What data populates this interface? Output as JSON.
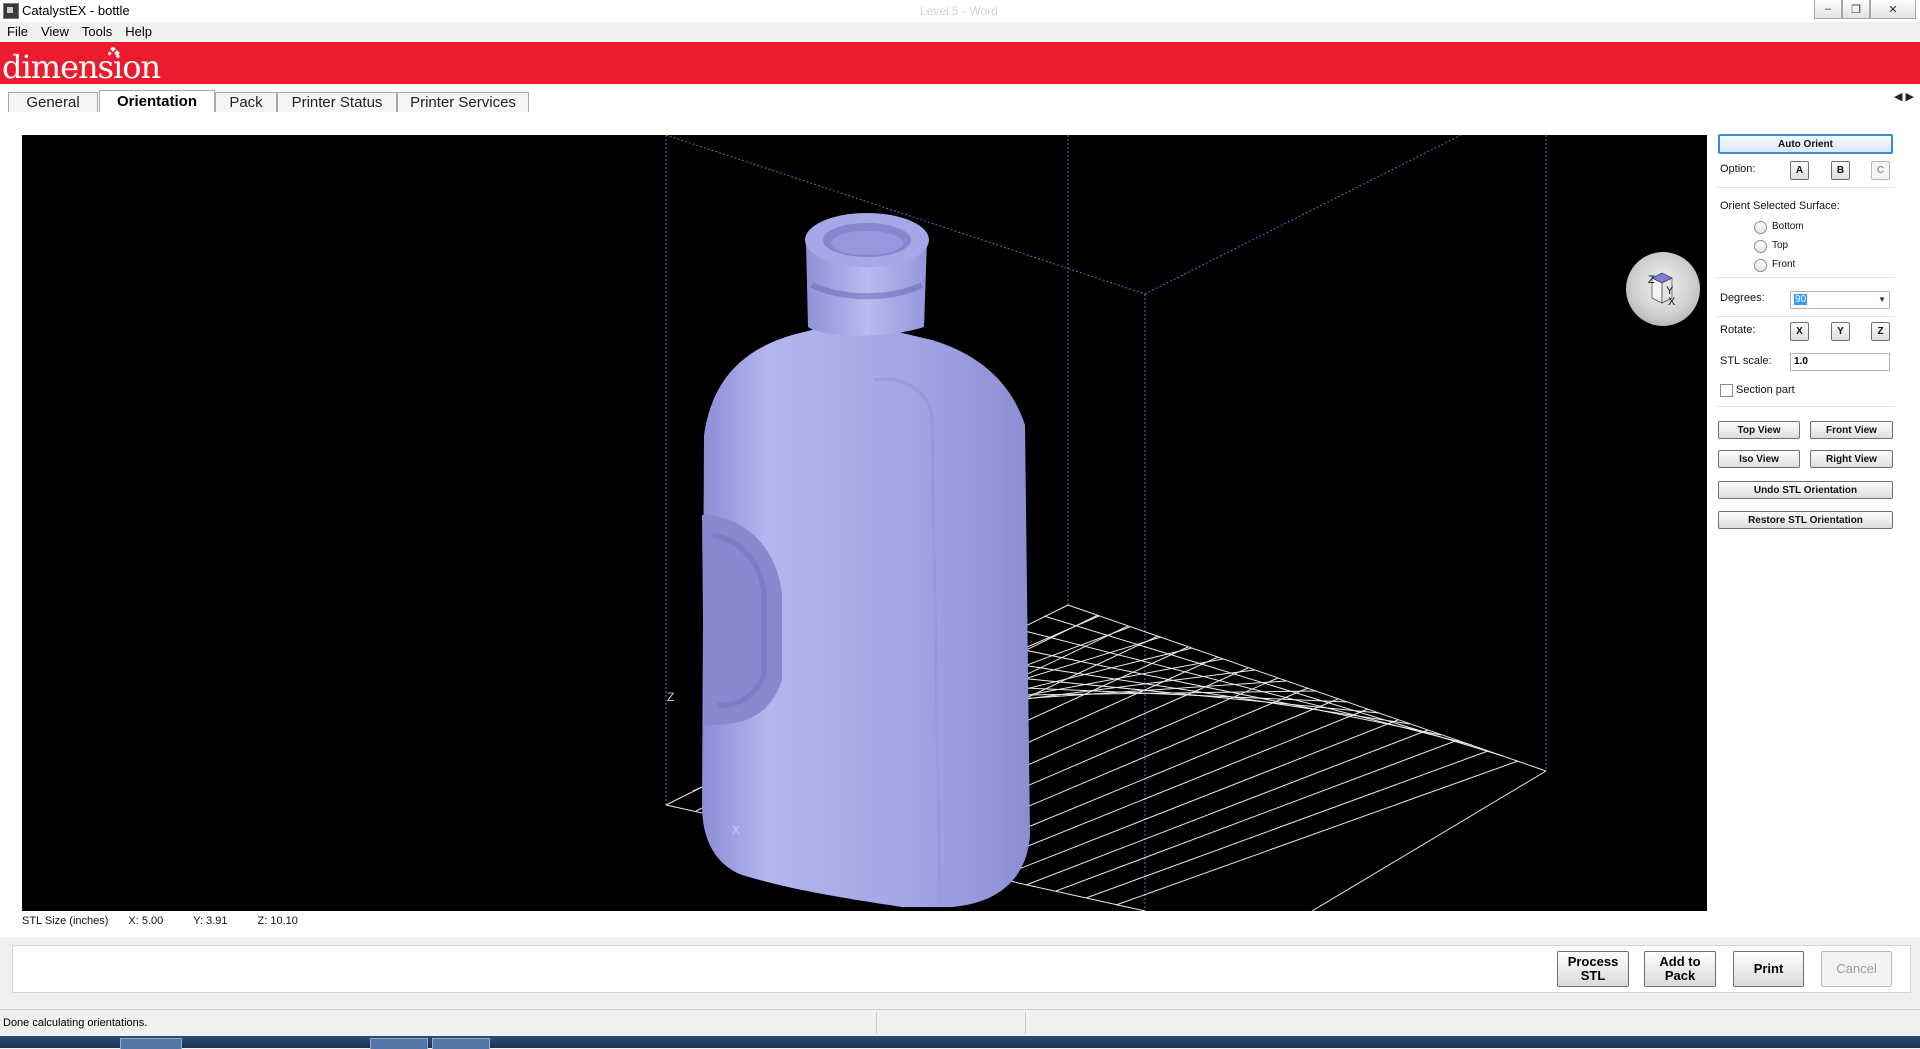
{
  "window": {
    "title": "CatalystEX - bottle",
    "background_title": "Level 5 - Word"
  },
  "menu": [
    "File",
    "View",
    "Tools",
    "Help"
  ],
  "brand": {
    "logo_text": "dimension",
    "color": "#ed1b2e"
  },
  "tabs": [
    {
      "label": "General",
      "active": false
    },
    {
      "label": "Orientation",
      "active": true
    },
    {
      "label": "Pack",
      "active": false
    },
    {
      "label": "Printer Status",
      "active": false
    },
    {
      "label": "Printer Services",
      "active": false
    }
  ],
  "viewport": {
    "axis_labels": {
      "z": "Z",
      "x": "X"
    },
    "nav_cube": {
      "z": "Z",
      "y": "Y",
      "x": "X"
    },
    "model_color": "#a9abe8"
  },
  "stl_size": {
    "label": "STL Size (inches)",
    "x": "X:  5.00",
    "y": "Y:  3.91",
    "z": "Z:  10.10"
  },
  "panel": {
    "auto_orient": "Auto Orient",
    "option_label": "Option:",
    "options": [
      "A",
      "B",
      "C"
    ],
    "orient_surface_label": "Orient Selected Surface:",
    "surfaces": [
      "Bottom",
      "Top",
      "Front"
    ],
    "degrees_label": "Degrees:",
    "degrees_value": "90",
    "rotate_label": "Rotate:",
    "rotate_axes": [
      "X",
      "Y",
      "Z"
    ],
    "scale_label": "STL scale:",
    "scale_value": "1.0",
    "section_part": "Section part",
    "top_view": "Top View",
    "front_view": "Front View",
    "iso_view": "Iso View",
    "right_view": "Right View",
    "undo_orientation": "Undo STL Orientation",
    "restore_orientation": "Restore STL Orientation"
  },
  "actions": {
    "process_stl": "Process STL",
    "add_to_pack": "Add to Pack",
    "print": "Print",
    "cancel": "Cancel"
  },
  "status": {
    "message": "Done calculating orientations."
  }
}
